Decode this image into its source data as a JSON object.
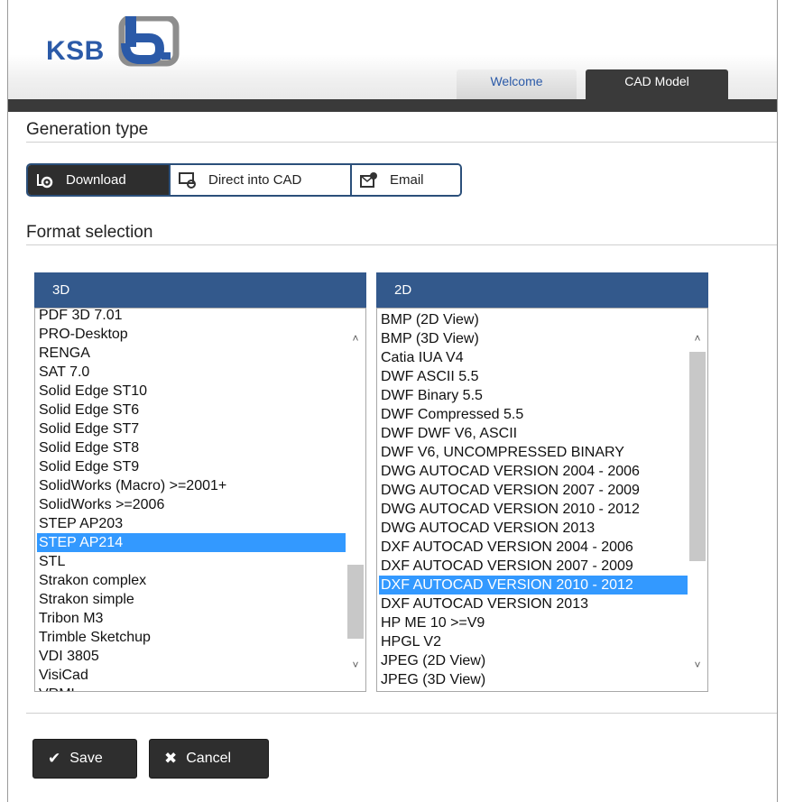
{
  "brand": {
    "logo_text": "KSB"
  },
  "tabs": [
    {
      "label": "Welcome",
      "active": false
    },
    {
      "label": "CAD Model",
      "active": true
    }
  ],
  "generation": {
    "title": "Generation type",
    "options": [
      {
        "label": "Download",
        "icon": "gear-download-icon",
        "active": true
      },
      {
        "label": "Direct into CAD",
        "icon": "cad-monitor-icon",
        "active": false
      },
      {
        "label": "Email",
        "icon": "email-gear-icon",
        "active": false
      }
    ]
  },
  "format": {
    "title": "Format selection",
    "list3d": {
      "header": "3D",
      "items": [
        "PDF 3D 7.01",
        "PRO-Desktop",
        "RENGA",
        "SAT 7.0",
        "Solid Edge ST10",
        "Solid Edge ST6",
        "Solid Edge ST7",
        "Solid Edge ST8",
        "Solid Edge ST9",
        "SolidWorks (Macro) >=2001+",
        "SolidWorks >=2006",
        "STEP AP203",
        "STEP AP214",
        "STL",
        "Strakon complex",
        "Strakon simple",
        "Tribon M3",
        "Trimble Sketchup",
        "VDI 3805",
        "VisiCad",
        "VRML"
      ],
      "selected": "STEP AP214"
    },
    "list2d": {
      "header": "2D",
      "items": [
        "BMP (2D View)",
        "BMP (3D View)",
        "Catia IUA V4",
        "DWF ASCII 5.5",
        "DWF Binary 5.5",
        "DWF Compressed 5.5",
        "DWF DWF V6, ASCII",
        "DWF V6, UNCOMPRESSED BINARY",
        "DWG AUTOCAD VERSION 2004 - 2006",
        "DWG AUTOCAD VERSION 2007 - 2009",
        "DWG AUTOCAD VERSION 2010 - 2012",
        "DWG AUTOCAD VERSION 2013",
        "DXF AUTOCAD VERSION 2004 - 2006",
        "DXF AUTOCAD VERSION 2007 - 2009",
        "DXF AUTOCAD VERSION 2010 - 2012",
        "DXF AUTOCAD VERSION 2013",
        "HP ME 10 >=V9",
        "HPGL V2",
        "JPEG (2D View)",
        "JPEG (3D View)"
      ],
      "selected": "DXF AUTOCAD VERSION 2010 - 2012"
    }
  },
  "actions": {
    "save_label": "Save",
    "cancel_label": "Cancel"
  },
  "colors": {
    "header_bar": "#3a3a3a",
    "list_header": "#33598c",
    "selection": "#3399ff",
    "brand_blue": "#2b5aa8"
  }
}
